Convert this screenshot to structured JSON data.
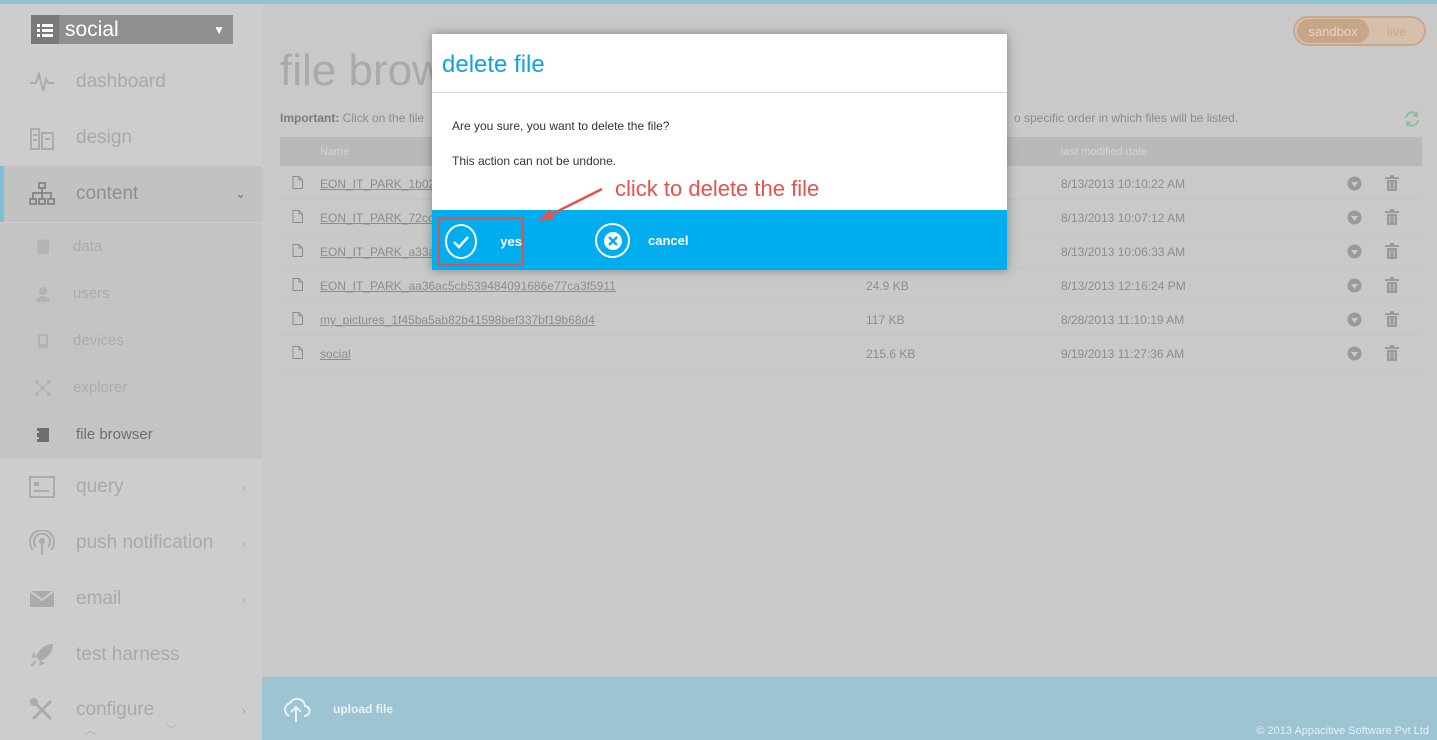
{
  "app_selector": {
    "name": "social"
  },
  "env_toggle": {
    "sandbox": "sandbox",
    "live": "live"
  },
  "sidebar": {
    "items": [
      {
        "label": "dashboard"
      },
      {
        "label": "design"
      },
      {
        "label": "content"
      },
      {
        "label": "query"
      },
      {
        "label": "push notification"
      },
      {
        "label": "email"
      },
      {
        "label": "test harness"
      },
      {
        "label": "configure"
      }
    ],
    "sub_items": [
      {
        "label": "data"
      },
      {
        "label": "users"
      },
      {
        "label": "devices"
      },
      {
        "label": "explorer"
      },
      {
        "label": "file browser"
      }
    ]
  },
  "main": {
    "title": "file brow",
    "important_label": "Important:",
    "important_text": "Click on the file",
    "important_tail": "o specific order in which files will be listed.",
    "table": {
      "headers": {
        "name": "Name",
        "date": "last modified date"
      },
      "rows": [
        {
          "name": "EON_IT_PARK_1b02",
          "size": "",
          "date": "8/13/2013 10:10:22 AM"
        },
        {
          "name": "EON_IT_PARK_72cc",
          "size": "",
          "date": "8/13/2013 10:07:12 AM"
        },
        {
          "name": "EON_IT_PARK_a33a",
          "size": "",
          "date": "8/13/2013 10:06:33 AM"
        },
        {
          "name": "EON_IT_PARK_aa36ac5cb539484091686e77ca3f5911",
          "size": "24.9 KB",
          "date": "8/13/2013 12:16:24 PM"
        },
        {
          "name": "my_pictures_1f45ba5ab82b41598bef337bf19b68d4",
          "size": "117 KB",
          "date": "8/28/2013 11:10:19 AM"
        },
        {
          "name": "social",
          "size": "215.6 KB",
          "date": "9/19/2013 11:27:36 AM"
        }
      ]
    }
  },
  "bottom_bar": {
    "upload_label": "upload file",
    "copyright": "© 2013 Appacitive Software Pvt Ltd"
  },
  "modal": {
    "title": "delete file",
    "line1": "Are you sure, you want to delete the file?",
    "line2": "This action can not be undone.",
    "yes_label": "yes",
    "cancel_label": "cancel"
  },
  "annotation": {
    "text": "click to delete the file"
  },
  "colors": {
    "accent": "#00adee",
    "title_blue": "#10a3e0",
    "annotation_red": "#e8524a",
    "bottom_bar": "#9cc4d3"
  }
}
